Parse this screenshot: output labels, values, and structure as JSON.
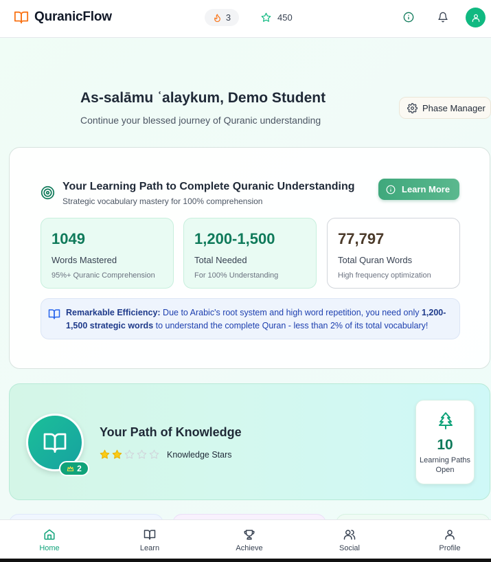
{
  "header": {
    "app_name": "QuranicFlow",
    "streak": "3",
    "points": "450"
  },
  "greeting": {
    "title": "As-salāmu ʿalaykum, Demo Student",
    "subtitle": "Continue your blessed journey of Quranic understanding",
    "phase_manager_label": "Phase Manager"
  },
  "learning_path": {
    "title": "Your Learning Path to Complete Quranic Understanding",
    "subtitle": "Strategic vocabulary mastery for 100% comprehension",
    "learn_more_label": "Learn More",
    "stats": [
      {
        "value": "1049",
        "label": "Words Mastered",
        "note": "95%+ Quranic Comprehension",
        "color": "#0f7a5a"
      },
      {
        "value": "1,200-1,500",
        "label": "Total Needed",
        "note": "For 100% Understanding",
        "color": "#0f7a5a"
      },
      {
        "value": "77,797",
        "label": "Total Quran Words",
        "note": "High frequency optimization",
        "color": "#4b3a2a"
      }
    ],
    "efficiency": {
      "lead": "Remarkable Efficiency:",
      "text_before": " Due to Arabic's root system and high word repetition, you need only ",
      "highlight": "1,200-1,500 strategic words",
      "text_after": " to understand the complete Quran - less than 2% of its total vocabulary!"
    }
  },
  "knowledge": {
    "title": "Your Path of Knowledge",
    "level": "2",
    "stars_filled": 2,
    "stars_total": 5,
    "stars_label": "Knowledge Stars",
    "paths_open_count": "10",
    "paths_open_label": "Learning Paths Open"
  },
  "nav": {
    "items": [
      {
        "label": "Home",
        "icon": "home-icon",
        "active": true
      },
      {
        "label": "Learn",
        "icon": "book-icon",
        "active": false
      },
      {
        "label": "Achieve",
        "icon": "trophy-icon",
        "active": false
      },
      {
        "label": "Social",
        "icon": "users-icon",
        "active": false
      },
      {
        "label": "Profile",
        "icon": "user-icon",
        "active": false
      }
    ]
  },
  "colors": {
    "brand_green": "#10b981",
    "accent_orange": "#f97316",
    "info_blue": "#1e40af"
  }
}
